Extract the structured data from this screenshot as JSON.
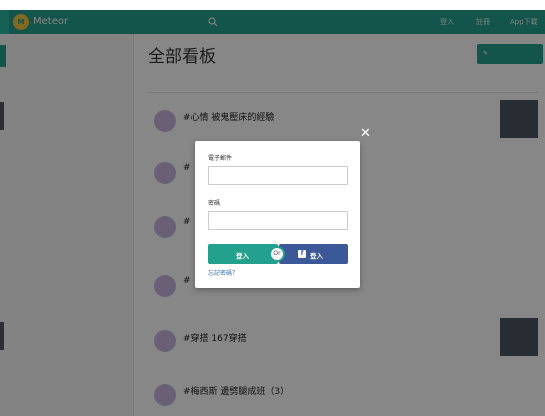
{
  "header": {
    "logo_text": "Meteor",
    "search_placeholder": "",
    "links": {
      "login": "登入",
      "register": "註冊",
      "app_download": "App下載"
    }
  },
  "sidebar": {
    "top_items": [
      "",
      ""
    ],
    "items": [
      "",
      "",
      "",
      "",
      "",
      "",
      "",
      "",
      "",
      "",
      "",
      "",
      "",
      "",
      "",
      ""
    ],
    "footer": ""
  },
  "main": {
    "page_title": "全部看板",
    "post_button": "",
    "tabs": [
      "",
      ""
    ],
    "posts": [
      {
        "cat": "",
        "title": "#心情 被鬼壓床的經驗",
        "sub": ""
      },
      {
        "cat": "",
        "title": "#",
        "sub": ""
      },
      {
        "cat": "",
        "title": "#",
        "sub": ""
      },
      {
        "cat": "",
        "title": "#",
        "sub": ""
      },
      {
        "cat": "",
        "title": "#穿搭 167穿搭",
        "sub": ""
      },
      {
        "cat": "",
        "title": "#梅西斯 邊劈腿成班（3）",
        "sub": ""
      }
    ]
  },
  "modal": {
    "email_label": "電子郵件",
    "password_label": "密碼",
    "login_button": "登入",
    "or_text": "Or",
    "fb_button": "登入",
    "forgot_link": "忘記密碼？"
  },
  "colors": {
    "brand": "#24a08e",
    "facebook": "#3b5998",
    "link": "#3a6fb0"
  }
}
